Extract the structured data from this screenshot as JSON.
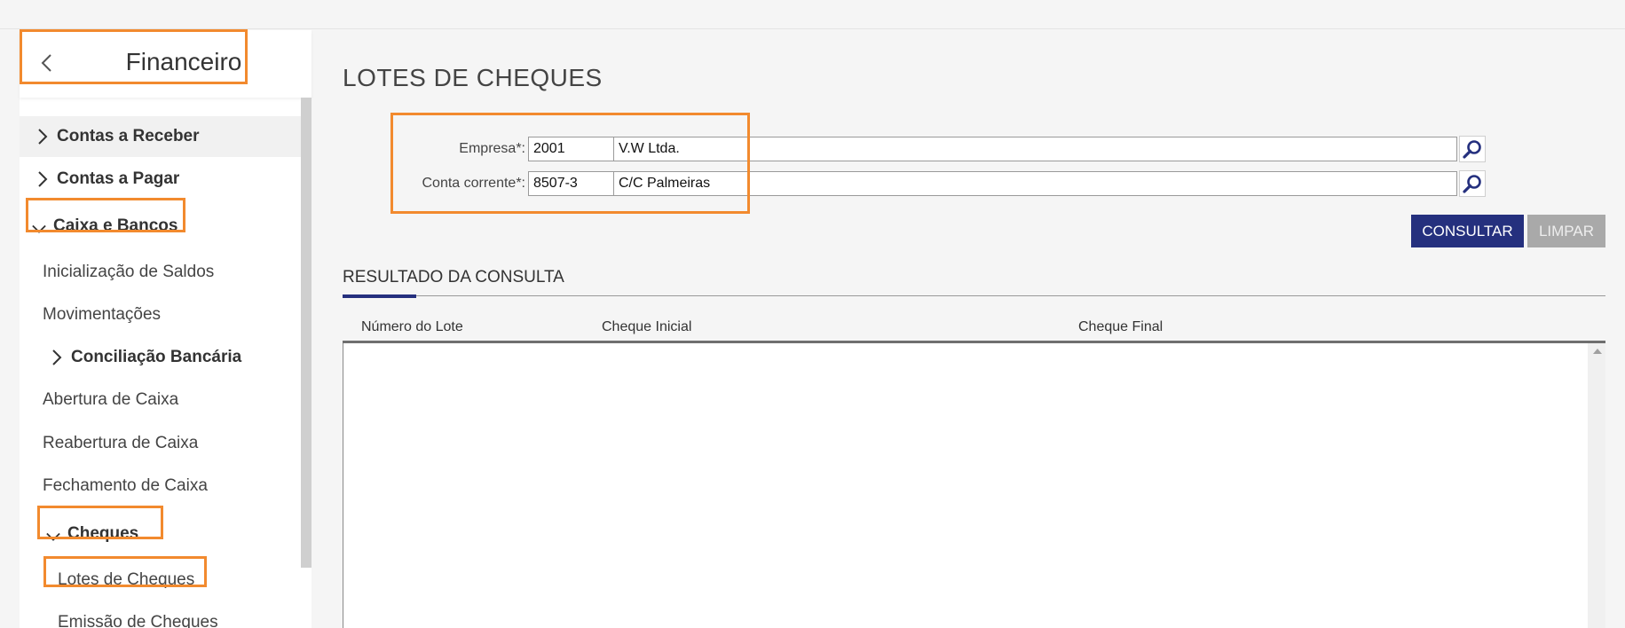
{
  "sidebar": {
    "title": "Financeiro",
    "items": [
      {
        "label": "Contas a Receber"
      },
      {
        "label": "Contas a Pagar"
      },
      {
        "label": "Caixa e Bancos"
      },
      {
        "label": "Inicialização de Saldos"
      },
      {
        "label": "Movimentações"
      },
      {
        "label": "Conciliação Bancária"
      },
      {
        "label": "Abertura de Caixa"
      },
      {
        "label": "Reabertura de Caixa"
      },
      {
        "label": "Fechamento de Caixa"
      },
      {
        "label": "Cheques"
      },
      {
        "label": "Lotes de Cheques"
      },
      {
        "label": "Emissão de Cheques"
      }
    ]
  },
  "page": {
    "title": "LOTES DE CHEQUES"
  },
  "form": {
    "empresa": {
      "label": "Empresa*:",
      "code": "2001",
      "name": "V.W Ltda."
    },
    "conta": {
      "label": "Conta corrente*:",
      "code": "8507-3",
      "name": "C/C Palmeiras"
    }
  },
  "buttons": {
    "consultar": "CONSULTAR",
    "limpar": "LIMPAR"
  },
  "results": {
    "title": "RESULTADO DA CONSULTA",
    "columns": [
      "Número do Lote",
      "Cheque Inicial",
      "Cheque Final"
    ],
    "rows": []
  },
  "colors": {
    "primary": "#25307e",
    "highlight": "#f28a2e",
    "disabled": "#a9a9a9"
  },
  "icons": {
    "back": "chevron-left-icon",
    "collapsed": "chevron-right-icon",
    "expanded": "chevron-down-icon",
    "search": "magnifier-icon"
  }
}
